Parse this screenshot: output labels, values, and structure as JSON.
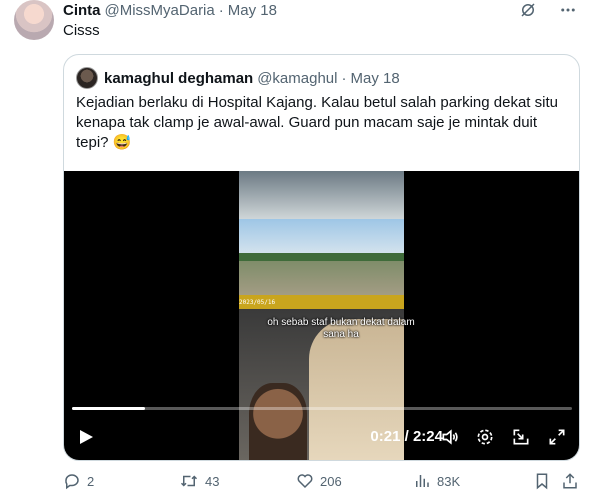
{
  "tweet": {
    "author_name": "Cinta",
    "author_handle": "@MissMyaDaria",
    "separator": "·",
    "date": "May 18",
    "text": "Cisss"
  },
  "quoted": {
    "author_name": "kamaghul deghaman",
    "author_handle": "@kamaghul",
    "separator": "·",
    "date": "May 18",
    "text": "Kejadian berlaku di Hospital Kajang. Kalau betul salah parking dekat situ kenapa tak clamp je awal-awal. Guard pun macam saje je mintak duit tepi? 😅"
  },
  "video": {
    "caption": "oh sebab staf bukan dekat dalam sana ha",
    "timestamp_overlay": "2023/05/16",
    "current_time": "0:21",
    "time_separator": " / ",
    "duration": "2:24",
    "progress_fraction": 0.146
  },
  "actions": {
    "replies": "2",
    "retweets": "43",
    "likes": "206",
    "views": "83K"
  },
  "colors": {
    "text": "#0f1419",
    "muted": "#536471",
    "border": "#cfd9de",
    "video_bg": "#000000"
  },
  "icons": {
    "top": [
      "grok-icon",
      "more-icon"
    ],
    "video_controls": [
      "play-icon",
      "volume-icon",
      "settings-icon",
      "minimize-icon",
      "fullscreen-icon"
    ],
    "actions": [
      "reply-icon",
      "retweet-icon",
      "like-icon",
      "views-icon",
      "bookmark-icon",
      "share-icon"
    ]
  }
}
